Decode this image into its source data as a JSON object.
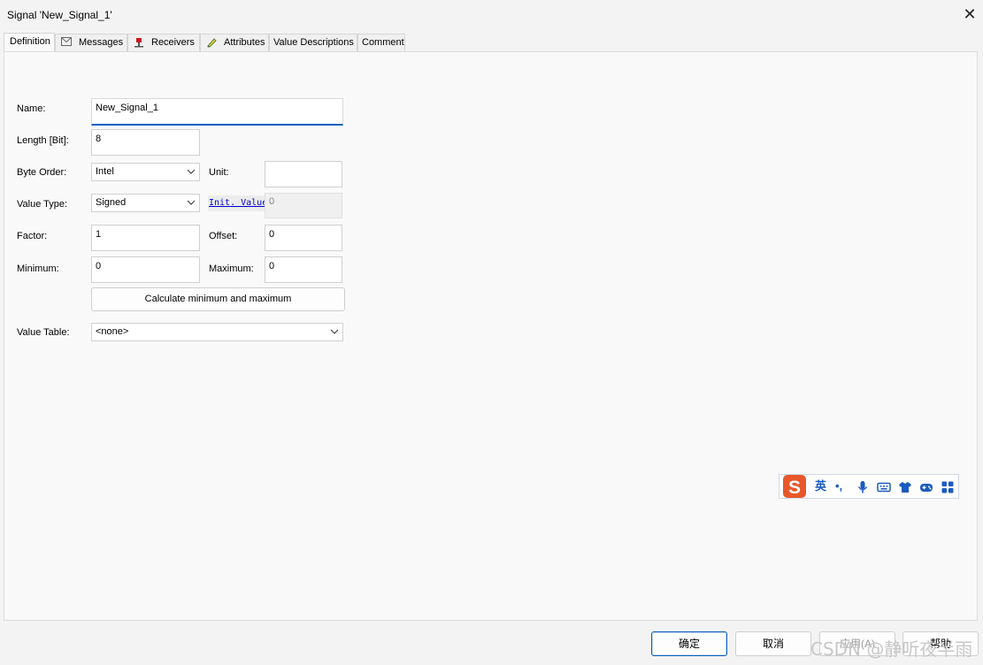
{
  "window": {
    "title": "Signal 'New_Signal_1'",
    "close_glyph": "✕"
  },
  "tabs": [
    {
      "label": "Definition",
      "icon": ""
    },
    {
      "label": "Messages",
      "icon": "envelope-icon"
    },
    {
      "label": "Receivers",
      "icon": "receiver-pin-icon"
    },
    {
      "label": "Attributes",
      "icon": "pencil-icon"
    },
    {
      "label": "Value Descriptions",
      "icon": ""
    },
    {
      "label": "Comment",
      "icon": ""
    }
  ],
  "form": {
    "name_label": "Name:",
    "name_value": "New_Signal_1",
    "length_label": "Length [Bit]:",
    "length_value": "8",
    "byte_order_label": "Byte Order:",
    "byte_order_value": "Intel",
    "unit_label": "Unit:",
    "unit_value": "",
    "value_type_label": "Value Type:",
    "value_type_value": "Signed",
    "init_value_label": "Init. Value",
    "init_value_value": "0",
    "factor_label": "Factor:",
    "factor_value": "1",
    "offset_label": "Offset:",
    "offset_value": "0",
    "minimum_label": "Minimum:",
    "minimum_value": "0",
    "maximum_label": "Maximum:",
    "maximum_value": "0",
    "calc_button": "Calculate minimum and maximum",
    "value_table_label": "Value Table:",
    "value_table_value": "<none>"
  },
  "ime_toolbar": {
    "logo": "S",
    "mode": "英",
    "punct": "•,",
    "icons": [
      "microphone-icon",
      "keyboard-icon",
      "shirt-icon",
      "gamepad-icon",
      "grid-icon"
    ]
  },
  "footer": {
    "ok": "确定",
    "cancel": "取消",
    "apply": "应用(A)",
    "help": "帮助"
  },
  "watermark": "CSDN @静听夜半雨",
  "colors": {
    "accent": "#0a5ebf",
    "link": "#0000cc",
    "ime_logo": "#e8572a",
    "ime_blue": "#1c5bbf"
  }
}
